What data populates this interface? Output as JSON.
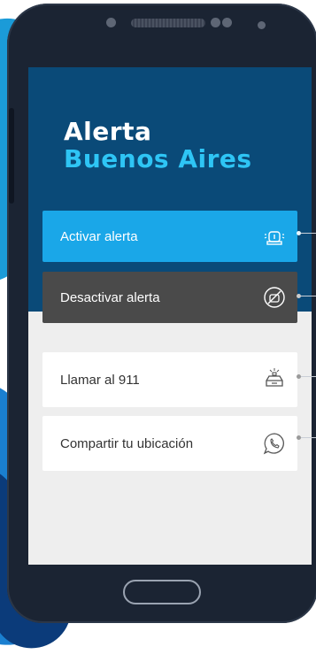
{
  "app": {
    "title_line1": "Alerta",
    "title_line2": "Buenos Aires"
  },
  "actions": [
    {
      "label": "Activar alerta",
      "icon": "siren-icon"
    },
    {
      "label": "Desactivar alerta",
      "icon": "alarm-off-icon"
    },
    {
      "label": "Llamar al 911",
      "icon": "police-car-icon"
    },
    {
      "label": "Compartir tu ubicación",
      "icon": "whatsapp-icon"
    }
  ],
  "colors": {
    "header_bg": "#0a4a78",
    "title_accent": "#2ec5f5",
    "activate_bg": "#1aa7e8",
    "deactivate_bg": "#4a4a4a",
    "screen_bg": "#eeeeee"
  }
}
